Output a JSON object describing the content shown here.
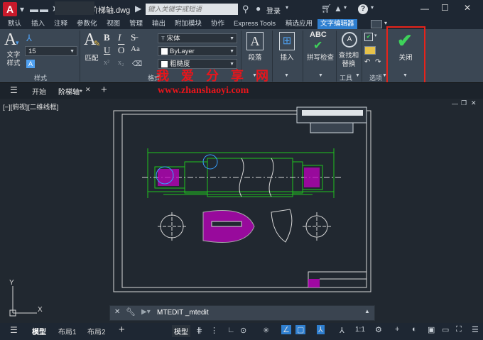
{
  "titlebar": {
    "app_logo": "A",
    "share_label": "共享",
    "document_title": "阶梯轴.dwg",
    "search_placeholder": "键入关键字或短语",
    "login_label": "登录",
    "help_icon": "?"
  },
  "menu_tabs": [
    "默认",
    "插入",
    "注释",
    "参数化",
    "视图",
    "管理",
    "输出",
    "附加模块",
    "协作",
    "Express Tools",
    "精选应用",
    "文字编辑器"
  ],
  "active_menu_tab": "文字编辑器",
  "ribbon": {
    "style_panel": {
      "text_style_label": "文字\n样式",
      "height_value": "15",
      "title": "样式"
    },
    "format_panel": {
      "match_label": "匹配",
      "bold": "B",
      "italic": "I",
      "font_value": "宋体",
      "color_value": "ByLayer",
      "title": "格式",
      "dimension_label": "粗糙度"
    },
    "paragraph_label": "段落",
    "insert_label": "插入",
    "spellcheck_label": "拼写检查",
    "find_replace_label": "查找和\n替换",
    "tools_title": "工具",
    "options_title": "选项",
    "close_label": "关闭"
  },
  "watermark": {
    "chinese": "我 爱 分 享 网",
    "url": "www.zhanshaoyi.com"
  },
  "file_tabs": {
    "start": "开始",
    "active": "阶梯轴*",
    "add": "+"
  },
  "viewport_label": "[−][俯视][二维线框]",
  "command": {
    "text": "MTEDIT _mtedit"
  },
  "ucs": {
    "x": "X",
    "y": "Y"
  },
  "statusbar": {
    "model_tab": "模型",
    "layout1": "布局1",
    "layout2": "布局2",
    "add": "+",
    "model_button": "模型",
    "scale": "1:1"
  },
  "colors": {
    "accent": "#2f7fd0",
    "close_highlight": "#e8231a",
    "drawing_green": "#1ec41e",
    "hatch_magenta": "#c000c0"
  }
}
